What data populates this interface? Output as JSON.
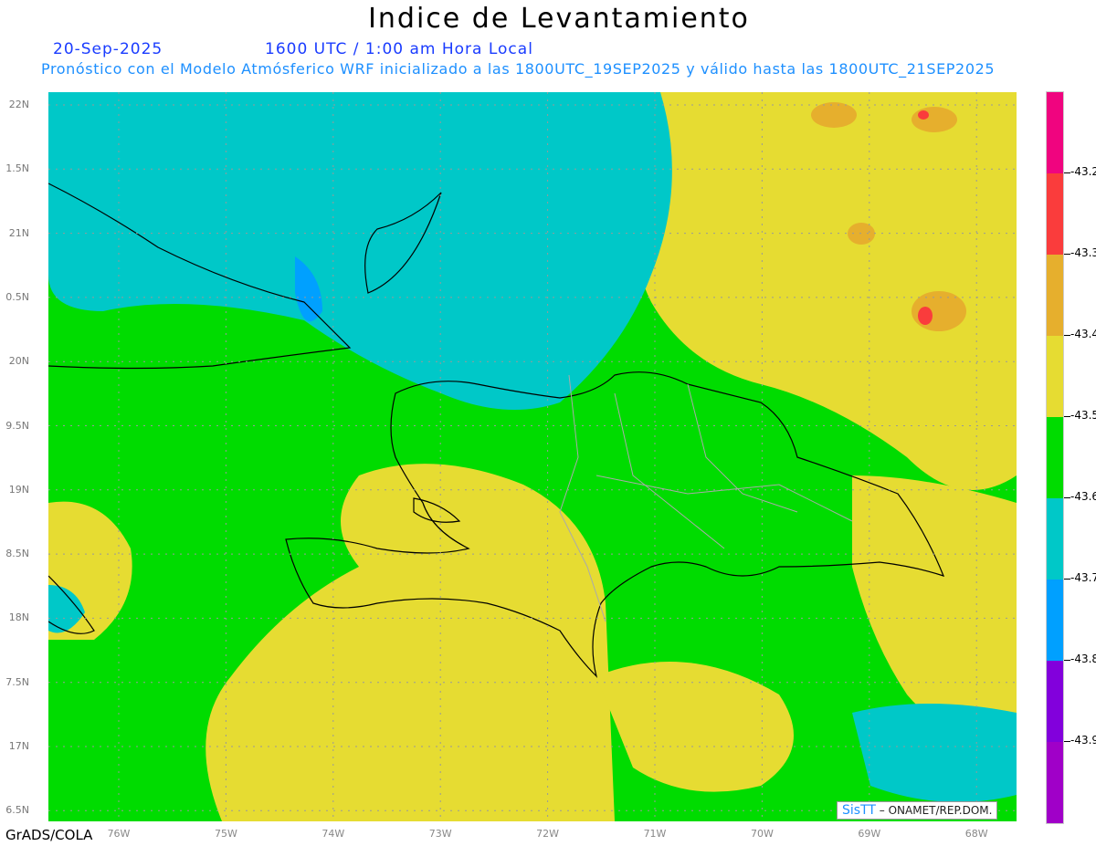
{
  "header": {
    "title": "Indice de Levantamiento",
    "date": "20-Sep-2025",
    "time": "1600 UTC / 1:00 am Hora Local",
    "subtitle": "Pronóstico con el Modelo Atmósferico WRF inicializado a las 1800UTC_19SEP2025 y válido hasta las  1800UTC_21SEP2025"
  },
  "map": {
    "lat_labels": [
      "22N",
      "1.5N",
      "21N",
      "0.5N",
      "20N",
      "9.5N",
      "19N",
      "8.5N",
      "18N",
      "7.5N",
      "17N",
      "6.5N"
    ],
    "lon_labels": [
      "76W",
      "75W",
      "74W",
      "73W",
      "72W",
      "71W",
      "70W",
      "69W",
      "68W"
    ]
  },
  "colorbar": {
    "colors": [
      "#f0047f",
      "#fa3c3c",
      "#e6af2d",
      "#e6dc32",
      "#00dc00",
      "#00c8c8",
      "#00a0ff",
      "#8200dc",
      "#a000c8"
    ],
    "labels": [
      "-43.2",
      "-43.3",
      "-43.4",
      "-43.5",
      "-43.6",
      "-43.7",
      "-43.8",
      "-43.9"
    ]
  },
  "footer": {
    "credit": "GrADS/COLA",
    "watermark_logo": "SisTT",
    "watermark_text": "– ONAMET/REP.DOM."
  }
}
